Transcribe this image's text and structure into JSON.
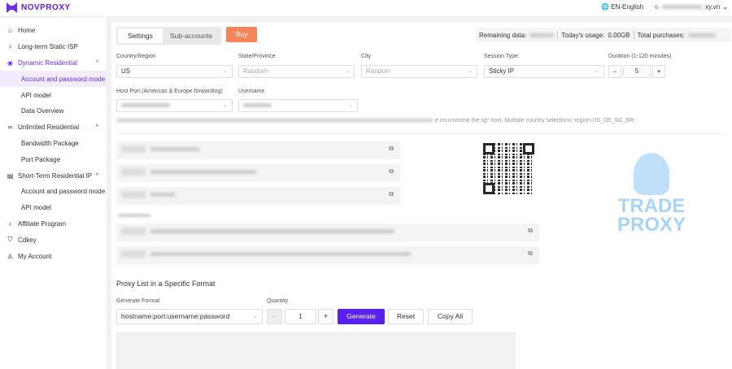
{
  "header": {
    "brand": "NOVPROXY",
    "language": "EN-English",
    "user_email_suffix": "xy.vn"
  },
  "sidebar": {
    "items": [
      {
        "label": "Home",
        "icon": "home-icon"
      },
      {
        "label": "Long-term Static ISP",
        "icon": "bulb-icon"
      },
      {
        "label": "Dynamic Residential",
        "icon": "drop-icon",
        "expanded": true
      },
      {
        "label": "Account and password mode",
        "sub": true,
        "active": true
      },
      {
        "label": "API model",
        "sub": true
      },
      {
        "label": "Data Overview",
        "sub": true
      },
      {
        "label": "Unlimited Residential",
        "icon": "infinity-icon",
        "expanded": true
      },
      {
        "label": "Bandwidth Package",
        "sub": true
      },
      {
        "label": "Port Package",
        "sub": true
      },
      {
        "label": "Short-Term Residential IP",
        "icon": "grid-icon",
        "expanded": true
      },
      {
        "label": "Account and password mode",
        "sub": true
      },
      {
        "label": "API model",
        "sub": true
      },
      {
        "label": "Affiliate Program",
        "icon": "award-icon"
      },
      {
        "label": "Cdkey",
        "icon": "shield-icon"
      },
      {
        "label": "My Account",
        "icon": "user-icon"
      }
    ]
  },
  "main": {
    "tabs": [
      "Settings",
      "Sub-accounts"
    ],
    "buy": "Buy",
    "stats": {
      "remaining_label": "Remaining data:",
      "today_label": "Today's usage:",
      "today_value": "0.00GB",
      "total_label": "Total purchases:"
    },
    "form": {
      "country_label": "Country/Region",
      "country_value": "US",
      "state_label": "State/Province",
      "state_placeholder": "Random",
      "city_label": "City",
      "city_placeholder": "Random",
      "session_label": "Session Type",
      "session_value": "Sticky IP",
      "duration_label": "Duration (1-120 minutes)",
      "duration_value": "5",
      "host_label": "Host Port (Americas & Europe forwarding)",
      "username_label": "Username"
    },
    "tips_visible": "e recommend the sg* host. Multiple country selections: region-US_DE_SG_BR",
    "proxy_list": {
      "title": "Proxy List in a Specific Format",
      "format_label": "Generate Format",
      "format_value": "hostname:port:username:password",
      "quantity_label": "Quantity",
      "quantity_value": "1",
      "generate": "Generate",
      "reset": "Reset",
      "copy_all": "Copy All"
    },
    "watermark": "TRADE PROXY",
    "accent": "#6d2cf0",
    "buy_color": "#f5865a",
    "generate_color": "#5b1ff0"
  }
}
